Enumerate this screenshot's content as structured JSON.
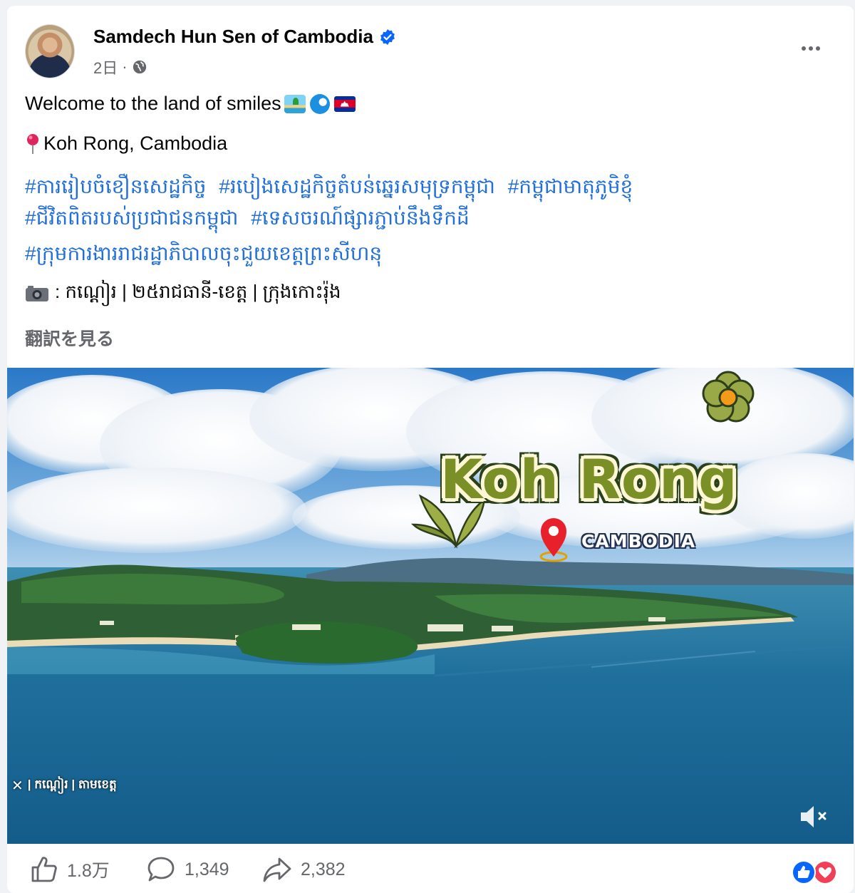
{
  "post": {
    "author": "Samdech Hun Sen of Cambodia",
    "time": "2日",
    "separator": "·",
    "text_line1": "Welcome to the land of smiles",
    "location": "Koh Rong, Cambodia",
    "hashtags_line1": [
      "#ការរៀបចំខឿនសេដ្ឋកិច្ច",
      "#របៀងសេដ្ឋកិច្ចតំបន់ឆ្នេរសមុទ្រកម្ពុជា",
      "#កម្ពុជាមាតុភូមិខ្ញុំ"
    ],
    "hashtags_line2": [
      "#ជីវិតពិតរបស់ប្រជាជនកម្ពុជា",
      "#ទេសចរណ៍ផ្សារភ្ជាប់នឹងទឹកដី"
    ],
    "hashtag_line3": "#ក្រុមការងាររាជរដ្ឋាភិបាលចុះជួយខេត្តព្រះសីហនុ",
    "credit": ": កណ្ដៀរ | ២៥រាជធានី-ខេត្ត | ក្រុងកោះរ៉ុង",
    "see_translation": "翻訳を見る"
  },
  "video": {
    "title": "Koh Rong",
    "subtitle": "CAMBODIA",
    "watermark": "| កណ្ដៀរ | តាមខេត្ត"
  },
  "stats": {
    "likes": "1.8万",
    "comments": "1,349",
    "shares": "2,382"
  },
  "icons": [
    "verified-badge-icon",
    "globe-icon",
    "more-icon",
    "island-emoji-icon",
    "wave-emoji-icon",
    "cambodia-flag-icon",
    "pin-icon",
    "camera-icon",
    "mute-icon",
    "like-icon",
    "comment-icon",
    "share-icon",
    "like-reaction-icon",
    "love-reaction-icon"
  ],
  "colors": {
    "link": "#216fdb",
    "secondary_text": "#65676b",
    "verified": "#0866ff",
    "love": "#f33e58"
  }
}
